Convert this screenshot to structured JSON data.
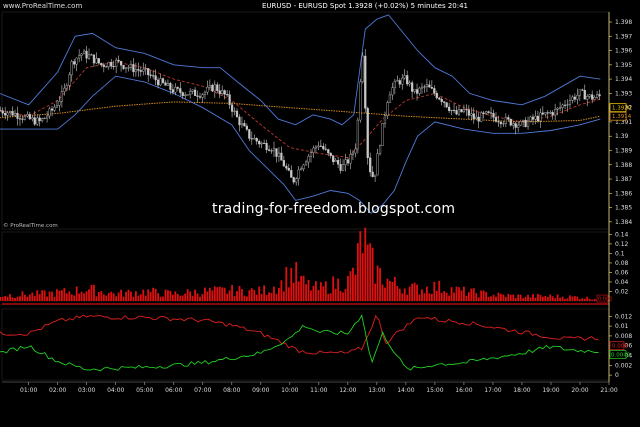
{
  "header": {
    "site": "www.ProRealTime.com",
    "title": "EURUSD - EURUSD Spot   1.3928 (+0.02%)   5 minutes  20:41"
  },
  "watermark": "trading-for-freedom.blogspot.com",
  "attribution": "© ProRealTime.com",
  "colors": {
    "background": "#000000",
    "candles": "#c8c8c8",
    "bollinger": "#4f7ad8",
    "bollinger_mid": "#c0392b",
    "long_ma": "#d28a1e",
    "volume": "#e01010",
    "osc_red": "#e02020",
    "osc_green": "#20d020",
    "axis": "#f0e080",
    "tag_price": "#f0c000"
  },
  "chart_data": [
    {
      "type": "candlestick",
      "name": "price",
      "x_ticks": [
        "01:00",
        "02:00",
        "03:00",
        "04:00",
        "05:00",
        "06:00",
        "07:00",
        "08:00",
        "09:00",
        "10:00",
        "11:00",
        "12:00",
        "13:00",
        "14:00",
        "15:00",
        "16:00",
        "17:00",
        "18:00",
        "19:00",
        "20:00",
        "21:00"
      ],
      "y_ticks": [
        "1.398",
        "1.397",
        "1.396",
        "1.395",
        "1.394",
        "1.393",
        "1.392",
        "1.391",
        "1.39",
        "1.389",
        "1.388",
        "1.387",
        "1.386",
        "1.385",
        "1.384"
      ],
      "ylim": [
        1.3835,
        1.3987
      ],
      "price_tags": [
        "1.3920",
        "1.3914"
      ],
      "close_path": [
        [
          0.0,
          1.3918
        ],
        [
          0.5,
          1.3916
        ],
        [
          1.0,
          1.3912
        ],
        [
          1.4,
          1.391
        ],
        [
          1.8,
          1.3918
        ],
        [
          2.2,
          1.393
        ],
        [
          2.5,
          1.3952
        ],
        [
          2.8,
          1.3958
        ],
        [
          3.1,
          1.3956
        ],
        [
          3.5,
          1.395
        ],
        [
          4.0,
          1.3952
        ],
        [
          4.5,
          1.3948
        ],
        [
          5.0,
          1.3945
        ],
        [
          5.5,
          1.3938
        ],
        [
          6.0,
          1.3932
        ],
        [
          6.5,
          1.393
        ],
        [
          7.0,
          1.393
        ],
        [
          7.4,
          1.3935
        ],
        [
          7.8,
          1.3928
        ],
        [
          8.2,
          1.3912
        ],
        [
          8.6,
          1.39
        ],
        [
          9.0,
          1.3895
        ],
        [
          9.4,
          1.3892
        ],
        [
          9.8,
          1.388
        ],
        [
          10.1,
          1.3868
        ],
        [
          10.4,
          1.388
        ],
        [
          10.7,
          1.3888
        ],
        [
          11.0,
          1.3895
        ],
        [
          11.4,
          1.3885
        ],
        [
          11.8,
          1.3878
        ],
        [
          12.1,
          1.3885
        ],
        [
          12.3,
          1.3895
        ],
        [
          12.5,
          1.3965
        ],
        [
          12.7,
          1.388
        ],
        [
          12.9,
          1.387
        ],
        [
          13.1,
          1.3895
        ],
        [
          13.4,
          1.393
        ],
        [
          13.7,
          1.3938
        ],
        [
          14.0,
          1.394
        ],
        [
          14.3,
          1.393
        ],
        [
          14.7,
          1.3935
        ],
        [
          15.0,
          1.393
        ],
        [
          15.3,
          1.3925
        ],
        [
          15.7,
          1.3915
        ],
        [
          16.0,
          1.3918
        ],
        [
          16.4,
          1.3912
        ],
        [
          16.8,
          1.3915
        ],
        [
          17.2,
          1.3912
        ],
        [
          17.6,
          1.391
        ],
        [
          18.0,
          1.3908
        ],
        [
          18.4,
          1.3912
        ],
        [
          18.8,
          1.3915
        ],
        [
          19.2,
          1.3918
        ],
        [
          19.6,
          1.3925
        ],
        [
          20.0,
          1.393
        ],
        [
          20.4,
          1.3927
        ],
        [
          20.7,
          1.3928
        ]
      ],
      "bollinger_upper": [
        [
          0.0,
          1.393
        ],
        [
          1.0,
          1.3922
        ],
        [
          2.0,
          1.3945
        ],
        [
          2.6,
          1.397
        ],
        [
          3.2,
          1.3972
        ],
        [
          4.0,
          1.3962
        ],
        [
          5.0,
          1.3958
        ],
        [
          6.0,
          1.395
        ],
        [
          7.0,
          1.3948
        ],
        [
          7.6,
          1.3948
        ],
        [
          8.2,
          1.3938
        ],
        [
          9.0,
          1.3925
        ],
        [
          9.6,
          1.3912
        ],
        [
          10.2,
          1.3908
        ],
        [
          10.8,
          1.3915
        ],
        [
          11.4,
          1.3912
        ],
        [
          11.8,
          1.3908
        ],
        [
          12.2,
          1.3915
        ],
        [
          12.6,
          1.3975
        ],
        [
          13.0,
          1.3982
        ],
        [
          13.4,
          1.3985
        ],
        [
          13.8,
          1.3975
        ],
        [
          14.4,
          1.396
        ],
        [
          15.0,
          1.3948
        ],
        [
          15.6,
          1.3942
        ],
        [
          16.2,
          1.393
        ],
        [
          17.0,
          1.3925
        ],
        [
          18.0,
          1.3922
        ],
        [
          18.8,
          1.3928
        ],
        [
          19.4,
          1.3935
        ],
        [
          20.0,
          1.3942
        ],
        [
          20.7,
          1.394
        ]
      ],
      "bollinger_mid": [
        [
          0.0,
          1.3918
        ],
        [
          1.0,
          1.3914
        ],
        [
          2.0,
          1.3925
        ],
        [
          3.0,
          1.3948
        ],
        [
          4.0,
          1.3952
        ],
        [
          5.0,
          1.3948
        ],
        [
          6.0,
          1.394
        ],
        [
          7.0,
          1.3935
        ],
        [
          8.0,
          1.3925
        ],
        [
          9.0,
          1.3908
        ],
        [
          10.0,
          1.3892
        ],
        [
          11.0,
          1.3888
        ],
        [
          12.0,
          1.3885
        ],
        [
          12.6,
          1.3898
        ],
        [
          13.2,
          1.3912
        ],
        [
          14.0,
          1.3925
        ],
        [
          15.0,
          1.393
        ],
        [
          16.0,
          1.392
        ],
        [
          17.0,
          1.3914
        ],
        [
          18.0,
          1.391
        ],
        [
          19.0,
          1.3914
        ],
        [
          20.0,
          1.3922
        ],
        [
          20.7,
          1.3926
        ]
      ],
      "bollinger_lower": [
        [
          0.0,
          1.3905
        ],
        [
          1.0,
          1.3905
        ],
        [
          2.0,
          1.3905
        ],
        [
          2.6,
          1.3915
        ],
        [
          3.2,
          1.3928
        ],
        [
          4.0,
          1.3942
        ],
        [
          5.0,
          1.3938
        ],
        [
          6.0,
          1.393
        ],
        [
          7.0,
          1.392
        ],
        [
          8.0,
          1.3908
        ],
        [
          8.6,
          1.389
        ],
        [
          9.2,
          1.3878
        ],
        [
          9.8,
          1.3866
        ],
        [
          10.2,
          1.3855
        ],
        [
          10.8,
          1.3858
        ],
        [
          11.4,
          1.3862
        ],
        [
          12.0,
          1.386
        ],
        [
          12.4,
          1.3855
        ],
        [
          12.8,
          1.3846
        ],
        [
          13.2,
          1.3852
        ],
        [
          13.6,
          1.3862
        ],
        [
          14.0,
          1.3882
        ],
        [
          14.4,
          1.39
        ],
        [
          15.0,
          1.391
        ],
        [
          16.0,
          1.3905
        ],
        [
          17.0,
          1.3902
        ],
        [
          18.0,
          1.3902
        ],
        [
          19.0,
          1.3904
        ],
        [
          20.0,
          1.3908
        ],
        [
          20.7,
          1.3912
        ]
      ],
      "long_ma": [
        [
          0.0,
          1.3913
        ],
        [
          2.0,
          1.3916
        ],
        [
          4.0,
          1.3921
        ],
        [
          6.0,
          1.3924
        ],
        [
          8.0,
          1.3923
        ],
        [
          10.0,
          1.392
        ],
        [
          12.0,
          1.3917
        ],
        [
          14.0,
          1.3914
        ],
        [
          16.0,
          1.3912
        ],
        [
          18.0,
          1.391
        ],
        [
          20.0,
          1.3911
        ],
        [
          20.7,
          1.3914
        ]
      ]
    },
    {
      "type": "bar",
      "name": "volume",
      "y_ticks": [
        "0.14",
        "0.12",
        "0.1",
        "0.08",
        "0.06",
        "0.04",
        "0.02"
      ],
      "ylim": [
        0,
        0.145
      ],
      "value_tag": "0.002",
      "profile": [
        [
          0.0,
          0.012
        ],
        [
          1.5,
          0.015
        ],
        [
          2.5,
          0.02
        ],
        [
          3.0,
          0.025
        ],
        [
          4.0,
          0.015
        ],
        [
          5.0,
          0.02
        ],
        [
          6.0,
          0.015
        ],
        [
          7.0,
          0.02
        ],
        [
          8.0,
          0.022
        ],
        [
          9.0,
          0.02
        ],
        [
          9.7,
          0.035
        ],
        [
          10.0,
          0.06
        ],
        [
          10.2,
          0.055
        ],
        [
          10.5,
          0.035
        ],
        [
          11.0,
          0.025
        ],
        [
          11.5,
          0.035
        ],
        [
          12.0,
          0.04
        ],
        [
          12.3,
          0.07
        ],
        [
          12.5,
          0.14
        ],
        [
          12.7,
          0.09
        ],
        [
          13.0,
          0.06
        ],
        [
          13.3,
          0.045
        ],
        [
          13.8,
          0.03
        ],
        [
          14.5,
          0.025
        ],
        [
          15.0,
          0.03
        ],
        [
          15.5,
          0.025
        ],
        [
          16.0,
          0.02
        ],
        [
          17.0,
          0.013
        ],
        [
          18.0,
          0.01
        ],
        [
          19.0,
          0.01
        ],
        [
          20.0,
          0.008
        ],
        [
          20.7,
          0.004
        ]
      ]
    },
    {
      "type": "line",
      "name": "oscillator",
      "y_ticks": [
        "0.012",
        "0.01",
        "0.008",
        "0.006",
        "0.004",
        "0.002",
        "0"
      ],
      "ylim": [
        -0.001,
        0.0135
      ],
      "value_tags": [
        "0.006",
        "0.0042"
      ],
      "red_line": [
        [
          0.0,
          0.0085
        ],
        [
          1.0,
          0.0085
        ],
        [
          2.0,
          0.011
        ],
        [
          3.0,
          0.012
        ],
        [
          4.0,
          0.0118
        ],
        [
          5.0,
          0.0118
        ],
        [
          6.0,
          0.0115
        ],
        [
          7.0,
          0.0112
        ],
        [
          8.0,
          0.0102
        ],
        [
          9.0,
          0.0085
        ],
        [
          9.8,
          0.0065
        ],
        [
          10.3,
          0.005
        ],
        [
          11.0,
          0.0045
        ],
        [
          12.0,
          0.0045
        ],
        [
          12.5,
          0.0055
        ],
        [
          13.0,
          0.0125
        ],
        [
          13.3,
          0.0065
        ],
        [
          13.8,
          0.0092
        ],
        [
          14.5,
          0.012
        ],
        [
          15.2,
          0.0112
        ],
        [
          16.0,
          0.0108
        ],
        [
          17.0,
          0.0098
        ],
        [
          18.0,
          0.0088
        ],
        [
          19.0,
          0.0078
        ],
        [
          19.6,
          0.0073
        ],
        [
          20.0,
          0.0075
        ],
        [
          20.7,
          0.0076
        ]
      ],
      "green_line": [
        [
          0.0,
          0.0045
        ],
        [
          1.0,
          0.006
        ],
        [
          2.0,
          0.0028
        ],
        [
          3.0,
          0.0012
        ],
        [
          4.0,
          0.0014
        ],
        [
          5.0,
          0.0016
        ],
        [
          6.0,
          0.002
        ],
        [
          7.0,
          0.0025
        ],
        [
          8.0,
          0.0035
        ],
        [
          9.0,
          0.0045
        ],
        [
          10.0,
          0.0075
        ],
        [
          10.5,
          0.0102
        ],
        [
          11.0,
          0.0088
        ],
        [
          12.0,
          0.0085
        ],
        [
          12.5,
          0.0125
        ],
        [
          12.8,
          0.0022
        ],
        [
          13.2,
          0.0085
        ],
        [
          14.0,
          0.0012
        ],
        [
          14.5,
          0.0015
        ],
        [
          15.0,
          0.0022
        ],
        [
          16.0,
          0.0025
        ],
        [
          17.0,
          0.0035
        ],
        [
          18.0,
          0.0045
        ],
        [
          19.0,
          0.0058
        ],
        [
          19.6,
          0.0052
        ],
        [
          20.0,
          0.005
        ],
        [
          20.7,
          0.0049
        ]
      ]
    }
  ]
}
